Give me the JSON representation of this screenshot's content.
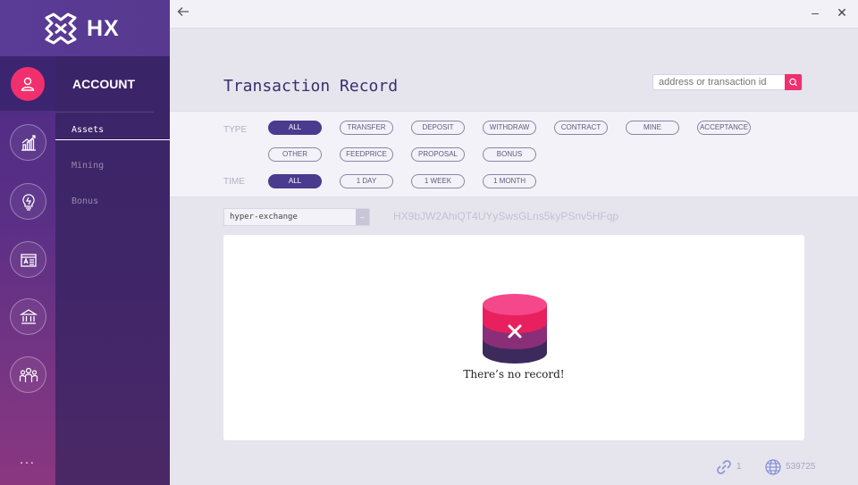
{
  "app": {
    "brand": "HX"
  },
  "titlebar": {
    "back_icon": "arrow-left-icon",
    "minimize_label": "–",
    "close_label": "✕"
  },
  "sidebar": {
    "items": [
      {
        "icon": "user-icon",
        "active": true
      },
      {
        "icon": "chart-icon",
        "active": false
      },
      {
        "icon": "idea-bulb-icon",
        "active": false
      },
      {
        "icon": "id-card-icon",
        "active": false
      },
      {
        "icon": "bank-icon",
        "active": false
      },
      {
        "icon": "group-icon",
        "active": false
      }
    ],
    "more_label": "..."
  },
  "subnav": {
    "title": "ACCOUNT",
    "items": [
      {
        "label": "Assets",
        "active": true
      },
      {
        "label": "Mining",
        "active": false
      },
      {
        "label": "Bonus",
        "active": false
      }
    ]
  },
  "page": {
    "title": "Transaction Record",
    "search_placeholder": "address or transaction id"
  },
  "filters": {
    "type_label": "TYPE",
    "time_label": "TIME",
    "type_options": [
      "ALL",
      "TRANSFER",
      "DEPOSIT",
      "WITHDRAW",
      "CONTRACT",
      "MINE",
      "ACCEPTANCE",
      "OTHER",
      "FEEDPRICE",
      "PROPOSAL",
      "BONUS"
    ],
    "type_selected": "ALL",
    "time_options": [
      "ALL",
      "1 DAY",
      "1 WEEK",
      "1 MONTH"
    ],
    "time_selected": "ALL"
  },
  "wallet": {
    "selected": "hyper-exchange",
    "address": "HX9bJW2AhiQT4UYySwsGLns5kyPSnv5HFqp"
  },
  "records": {
    "empty_message": "There’s no record!"
  },
  "status": {
    "connections": "1",
    "block_height": "539725"
  },
  "colors": {
    "accent": "#f0306e",
    "primary": "#4b3b8e",
    "sidebar": "#3f2669"
  }
}
